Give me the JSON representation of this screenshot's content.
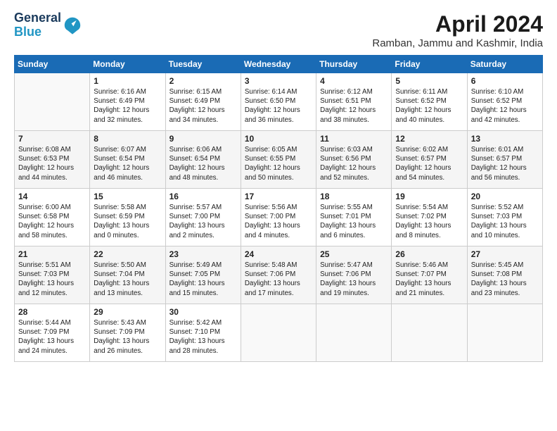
{
  "header": {
    "logo_line1": "General",
    "logo_line2": "Blue",
    "month": "April 2024",
    "location": "Ramban, Jammu and Kashmir, India"
  },
  "weekdays": [
    "Sunday",
    "Monday",
    "Tuesday",
    "Wednesday",
    "Thursday",
    "Friday",
    "Saturday"
  ],
  "weeks": [
    [
      {
        "day": "",
        "info": ""
      },
      {
        "day": "1",
        "info": "Sunrise: 6:16 AM\nSunset: 6:49 PM\nDaylight: 12 hours\nand 32 minutes."
      },
      {
        "day": "2",
        "info": "Sunrise: 6:15 AM\nSunset: 6:49 PM\nDaylight: 12 hours\nand 34 minutes."
      },
      {
        "day": "3",
        "info": "Sunrise: 6:14 AM\nSunset: 6:50 PM\nDaylight: 12 hours\nand 36 minutes."
      },
      {
        "day": "4",
        "info": "Sunrise: 6:12 AM\nSunset: 6:51 PM\nDaylight: 12 hours\nand 38 minutes."
      },
      {
        "day": "5",
        "info": "Sunrise: 6:11 AM\nSunset: 6:52 PM\nDaylight: 12 hours\nand 40 minutes."
      },
      {
        "day": "6",
        "info": "Sunrise: 6:10 AM\nSunset: 6:52 PM\nDaylight: 12 hours\nand 42 minutes."
      }
    ],
    [
      {
        "day": "7",
        "info": "Sunrise: 6:08 AM\nSunset: 6:53 PM\nDaylight: 12 hours\nand 44 minutes."
      },
      {
        "day": "8",
        "info": "Sunrise: 6:07 AM\nSunset: 6:54 PM\nDaylight: 12 hours\nand 46 minutes."
      },
      {
        "day": "9",
        "info": "Sunrise: 6:06 AM\nSunset: 6:54 PM\nDaylight: 12 hours\nand 48 minutes."
      },
      {
        "day": "10",
        "info": "Sunrise: 6:05 AM\nSunset: 6:55 PM\nDaylight: 12 hours\nand 50 minutes."
      },
      {
        "day": "11",
        "info": "Sunrise: 6:03 AM\nSunset: 6:56 PM\nDaylight: 12 hours\nand 52 minutes."
      },
      {
        "day": "12",
        "info": "Sunrise: 6:02 AM\nSunset: 6:57 PM\nDaylight: 12 hours\nand 54 minutes."
      },
      {
        "day": "13",
        "info": "Sunrise: 6:01 AM\nSunset: 6:57 PM\nDaylight: 12 hours\nand 56 minutes."
      }
    ],
    [
      {
        "day": "14",
        "info": "Sunrise: 6:00 AM\nSunset: 6:58 PM\nDaylight: 12 hours\nand 58 minutes."
      },
      {
        "day": "15",
        "info": "Sunrise: 5:58 AM\nSunset: 6:59 PM\nDaylight: 13 hours\nand 0 minutes."
      },
      {
        "day": "16",
        "info": "Sunrise: 5:57 AM\nSunset: 7:00 PM\nDaylight: 13 hours\nand 2 minutes."
      },
      {
        "day": "17",
        "info": "Sunrise: 5:56 AM\nSunset: 7:00 PM\nDaylight: 13 hours\nand 4 minutes."
      },
      {
        "day": "18",
        "info": "Sunrise: 5:55 AM\nSunset: 7:01 PM\nDaylight: 13 hours\nand 6 minutes."
      },
      {
        "day": "19",
        "info": "Sunrise: 5:54 AM\nSunset: 7:02 PM\nDaylight: 13 hours\nand 8 minutes."
      },
      {
        "day": "20",
        "info": "Sunrise: 5:52 AM\nSunset: 7:03 PM\nDaylight: 13 hours\nand 10 minutes."
      }
    ],
    [
      {
        "day": "21",
        "info": "Sunrise: 5:51 AM\nSunset: 7:03 PM\nDaylight: 13 hours\nand 12 minutes."
      },
      {
        "day": "22",
        "info": "Sunrise: 5:50 AM\nSunset: 7:04 PM\nDaylight: 13 hours\nand 13 minutes."
      },
      {
        "day": "23",
        "info": "Sunrise: 5:49 AM\nSunset: 7:05 PM\nDaylight: 13 hours\nand 15 minutes."
      },
      {
        "day": "24",
        "info": "Sunrise: 5:48 AM\nSunset: 7:06 PM\nDaylight: 13 hours\nand 17 minutes."
      },
      {
        "day": "25",
        "info": "Sunrise: 5:47 AM\nSunset: 7:06 PM\nDaylight: 13 hours\nand 19 minutes."
      },
      {
        "day": "26",
        "info": "Sunrise: 5:46 AM\nSunset: 7:07 PM\nDaylight: 13 hours\nand 21 minutes."
      },
      {
        "day": "27",
        "info": "Sunrise: 5:45 AM\nSunset: 7:08 PM\nDaylight: 13 hours\nand 23 minutes."
      }
    ],
    [
      {
        "day": "28",
        "info": "Sunrise: 5:44 AM\nSunset: 7:09 PM\nDaylight: 13 hours\nand 24 minutes."
      },
      {
        "day": "29",
        "info": "Sunrise: 5:43 AM\nSunset: 7:09 PM\nDaylight: 13 hours\nand 26 minutes."
      },
      {
        "day": "30",
        "info": "Sunrise: 5:42 AM\nSunset: 7:10 PM\nDaylight: 13 hours\nand 28 minutes."
      },
      {
        "day": "",
        "info": ""
      },
      {
        "day": "",
        "info": ""
      },
      {
        "day": "",
        "info": ""
      },
      {
        "day": "",
        "info": ""
      }
    ]
  ]
}
